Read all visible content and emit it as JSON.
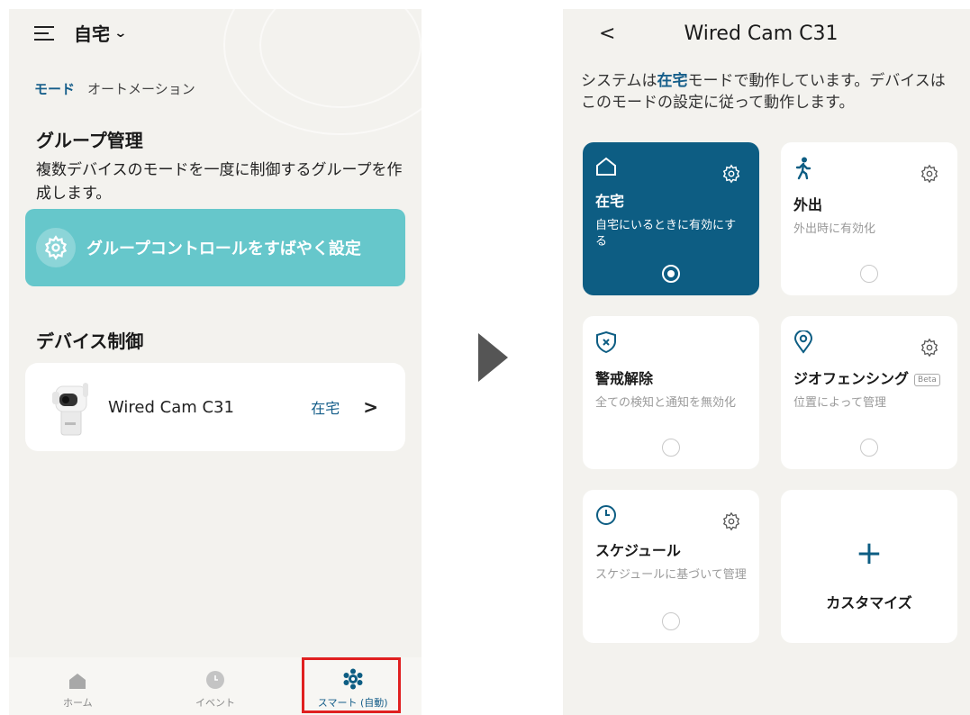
{
  "left": {
    "home_name": "自宅",
    "tabs": [
      "モード",
      "オートメーション"
    ],
    "group": {
      "title": "グループ管理",
      "description": "複数デバイスのモードを一度に制御するグループを作成します。",
      "button_label": "グループコントロールをすばやく設定"
    },
    "device_control": {
      "title": "デバイス制御",
      "device_name": "Wired Cam C31",
      "device_mode": "在宅"
    },
    "nav": [
      "ホーム",
      "イベント",
      "スマート (自動)"
    ]
  },
  "right": {
    "title": "Wired Cam C31",
    "desc_prefix": "システムは",
    "desc_mode": "在宅",
    "desc_suffix": "モードで動作しています。デバイスはこのモードの設定に従って動作します。",
    "modes": [
      {
        "name": "在宅",
        "sub": "自宅にいるときに有効にする",
        "selected": true
      },
      {
        "name": "外出",
        "sub": "外出時に有効化",
        "selected": false
      },
      {
        "name": "警戒解除",
        "sub": "全ての検知と通知を無効化",
        "selected": false
      },
      {
        "name": "ジオフェンシング",
        "sub": "位置によって管理",
        "badge": "Beta",
        "selected": false
      },
      {
        "name": "スケジュール",
        "sub": "スケジュールに基づいて管理",
        "selected": false
      }
    ],
    "customize_label": "カスタマイズ"
  },
  "colors": {
    "primary": "#0d5d83",
    "teal": "#66c7cb",
    "highlight": "#e02020"
  }
}
